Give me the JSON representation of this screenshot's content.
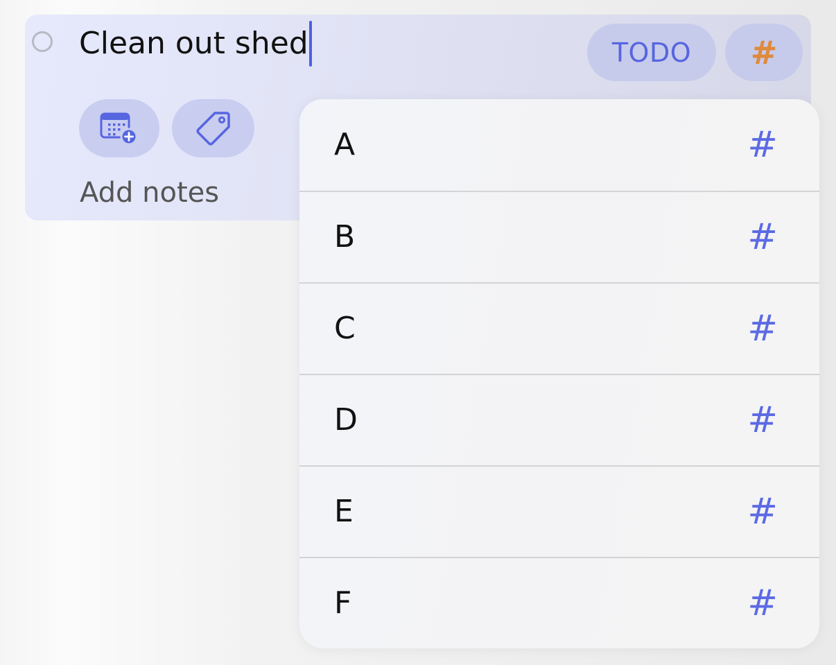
{
  "task": {
    "title": "Clean out shed",
    "status": "TODO",
    "tag_symbol": "#",
    "notes_placeholder": "Add notes"
  },
  "icons": {
    "checkbox": "circle-outline-icon",
    "date": "calendar-add-icon",
    "label": "tag-icon"
  },
  "tag_dropdown": {
    "items": [
      {
        "label": "A",
        "symbol": "#"
      },
      {
        "label": "B",
        "symbol": "#"
      },
      {
        "label": "C",
        "symbol": "#"
      },
      {
        "label": "D",
        "symbol": "#"
      },
      {
        "label": "E",
        "symbol": "#"
      },
      {
        "label": "F",
        "symbol": "#"
      }
    ]
  },
  "colors": {
    "accent": "#5665e0",
    "tag_accent": "#df8a3c",
    "card_background": "#e0e2f4"
  }
}
